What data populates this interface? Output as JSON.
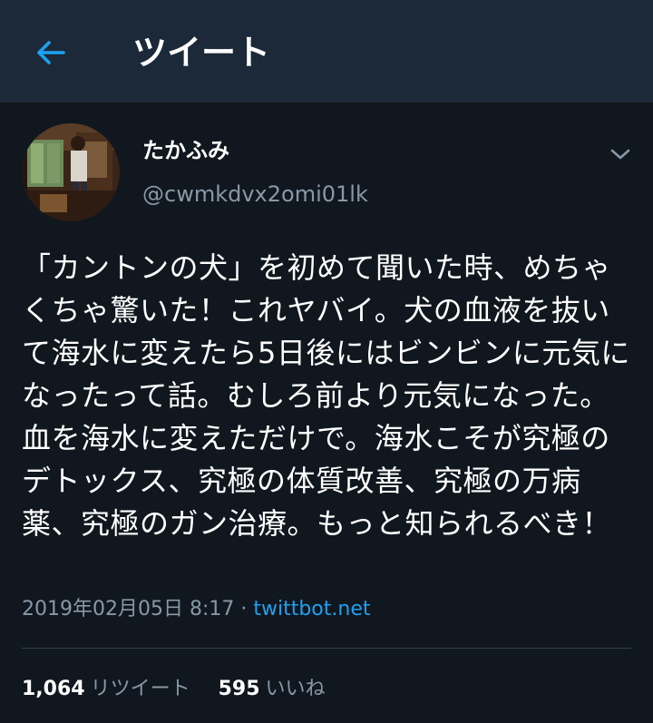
{
  "header": {
    "back_icon": "arrow-left-icon",
    "title": "ツイート"
  },
  "colors": {
    "background": "#10171e",
    "header": "#1c2938",
    "accent": "#1da1f2",
    "secondary_text": "#8899a6"
  },
  "tweet": {
    "author_name": "たかふみ",
    "author_handle": "@cwmkdvx2omi01lk",
    "menu_icon": "chevron-down-icon",
    "text": "「カントンの犬」を初めて聞いた時、めちゃくちゃ驚いた！これヤバイ。犬の血液を抜いて海水に変えたら5日後にはビンビンに元気になったって話。むしろ前より元気になった。血を海水に変えただけで。海水こそが究極のデトックス、究極の体質改善、究極の万病薬、究極のガン治療。もっと知られるべき！",
    "timestamp": "2019年02月05日 8:17",
    "separator": " · ",
    "source": "twittbot.net"
  },
  "stats": {
    "retweets_count": "1,064",
    "retweets_label": "リツイート",
    "likes_count": "595",
    "likes_label": "いいね"
  }
}
